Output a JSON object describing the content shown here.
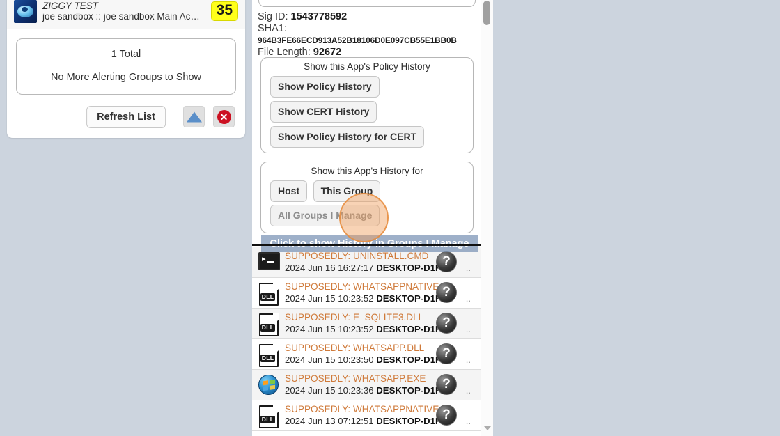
{
  "left_panel": {
    "group": {
      "title": "ZIGGY TEST",
      "subtitle": "joe sandbox :: joe sandbox Main Ac…",
      "badge": "35",
      "icon": "ziggy-logo-icon"
    },
    "summary": {
      "total": "1 Total",
      "message": "No More Alerting Groups to Show"
    },
    "refresh_label": "Refresh List",
    "up_icon": "up-triangle-icon",
    "close_icon": "close-x-icon"
  },
  "right_panel": {
    "meta": {
      "sig_id_label": "Sig ID:",
      "sig_id_value": "1543778592",
      "sha1_label": "SHA1:",
      "sha1_value": "964B3FE66ECD913A52B18106D0E097CB55E1BB0B",
      "file_length_label": "File Length:",
      "file_length_value": "92672"
    },
    "policy_history": {
      "title": "Show this App's Policy History",
      "buttons": [
        "Show Policy History",
        "Show CERT History",
        "Show Policy History for CERT"
      ]
    },
    "app_history": {
      "title": "Show this App's History for",
      "buttons": [
        "Host",
        "This Group"
      ],
      "wide_button": "All Groups I Manage"
    },
    "tooltip": "Click to show History in Groups I Manage",
    "files": [
      {
        "icon": "cmd-file-icon",
        "name": "SUPPOSEDLY: UNINSTALL.CMD",
        "timestamp": "2024 Jun 16 16:27:17",
        "host": "DESKTOP-D1F",
        "help_icon": "question-mark-icon",
        "dots": ".."
      },
      {
        "icon": "dll-file-icon",
        "name": "SUPPOSEDLY: WHATSAPPNATIVE.|",
        "timestamp": "2024 Jun 15 10:23:52",
        "host": "DESKTOP-D1F",
        "help_icon": "question-mark-icon",
        "dots": ".."
      },
      {
        "icon": "dll-file-icon",
        "name": "SUPPOSEDLY: E_SQLITE3.DLL",
        "timestamp": "2024 Jun 15 10:23:52",
        "host": "DESKTOP-D1F",
        "help_icon": "question-mark-icon",
        "dots": ".."
      },
      {
        "icon": "dll-file-icon",
        "name": "SUPPOSEDLY: WHATSAPP.DLL",
        "timestamp": "2024 Jun 15 10:23:50",
        "host": "DESKTOP-D1F",
        "help_icon": "question-mark-icon",
        "dots": ".."
      },
      {
        "icon": "windows-logo-icon",
        "name": "SUPPOSEDLY: WHATSAPP.EXE",
        "timestamp": "2024 Jun 15 10:23:36",
        "host": "DESKTOP-D1F",
        "help_icon": "question-mark-icon",
        "dots": ".."
      },
      {
        "icon": "dll-file-icon",
        "name": "SUPPOSEDLY: WHATSAPPNATIVE.|",
        "timestamp": "2024 Jun 13 07:12:51",
        "host": "DESKTOP-D1F",
        "help_icon": "question-mark-icon",
        "dots": ".."
      }
    ],
    "dll_badge_text": "DLL",
    "help_glyph": "?"
  },
  "colors": {
    "page_background": "#ccd4de",
    "badge_yellow": "#ffff1a",
    "file_name_orange": "#cf7a3a",
    "tooltip_blue": "#7891b4",
    "cursor_highlight": "#e68c3c",
    "primary_button_blue": "#2815c0"
  }
}
